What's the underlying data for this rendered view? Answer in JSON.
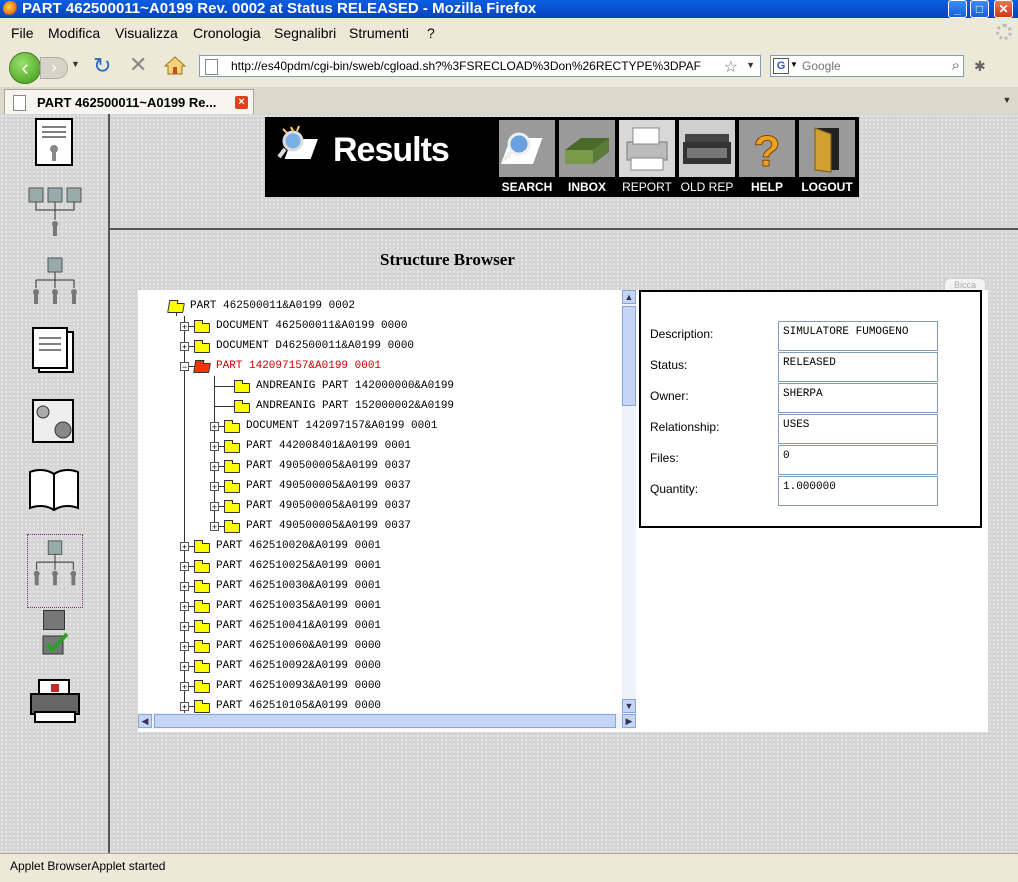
{
  "window": {
    "title": "PART 462500011~A0199 Rev. 0002 at Status RELEASED - Mozilla Firefox"
  },
  "menu": [
    "File",
    "Modifica",
    "Visualizza",
    "Cronologia",
    "Segnalibri",
    "Strumenti",
    "?"
  ],
  "nav": {
    "url": "http://es40pdm/cgi-bin/sweb/cgload.sh?%3FSRECLOAD%3Don%26RECTYPE%3DPAF",
    "search_placeholder": "Google"
  },
  "tab": {
    "label": "PART 462500011~A0199 Re..."
  },
  "banner": {
    "title": "Results",
    "buttons": [
      "SEARCH",
      "INBOX",
      "REPORT",
      "OLD REP",
      "HELP",
      "LOGOUT"
    ]
  },
  "page_title": "Structure Browser",
  "side_tab": "Bicca",
  "tree": [
    {
      "label": "PART 462500011&A0199 0002"
    },
    {
      "label": "DOCUMENT 462500011&A0199 0000"
    },
    {
      "label": "DOCUMENT D462500011&A0199 0000"
    },
    {
      "label": "PART 142097157&A0199 0001"
    },
    {
      "label": "ANDREANIG PART 142000000&A0199"
    },
    {
      "label": "ANDREANIG PART 152000002&A0199"
    },
    {
      "label": "DOCUMENT 142097157&A0199 0001"
    },
    {
      "label": "PART 442008401&A0199 0001"
    },
    {
      "label": "PART 490500005&A0199 0037"
    },
    {
      "label": "PART 490500005&A0199 0037"
    },
    {
      "label": "PART 490500005&A0199 0037"
    },
    {
      "label": "PART 490500005&A0199 0037"
    },
    {
      "label": "PART 462510020&A0199 0001"
    },
    {
      "label": "PART 462510025&A0199 0001"
    },
    {
      "label": "PART 462510030&A0199 0001"
    },
    {
      "label": "PART 462510035&A0199 0001"
    },
    {
      "label": "PART 462510041&A0199 0001"
    },
    {
      "label": "PART 462510060&A0199 0000"
    },
    {
      "label": "PART 462510092&A0199 0000"
    },
    {
      "label": "PART 462510093&A0199 0000"
    },
    {
      "label": "PART 462510105&A0199 0000"
    }
  ],
  "details": {
    "labels": [
      "Description:",
      "Status:",
      "Owner:",
      "Relationship:",
      "Files:",
      "Quantity:"
    ],
    "values": [
      "SIMULATORE FUMOGENO",
      "RELEASED",
      "SHERPA",
      "USES",
      "0",
      "1.000000"
    ]
  },
  "status": "Applet BrowserApplet started"
}
